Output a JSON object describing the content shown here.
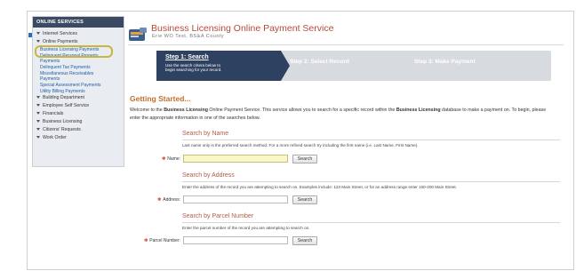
{
  "sidebar": {
    "heading": "ONLINE SERVICES",
    "items": [
      {
        "label": "Internet Services",
        "arrow": true
      },
      {
        "label": "Online Payments",
        "arrow": true
      }
    ],
    "payments_sub": [
      {
        "label": "Business Licensing Payments"
      },
      {
        "label": "Delinquent Personal Property Payments"
      },
      {
        "label": "Delinquent Tax Payments"
      },
      {
        "label": "Miscellaneous Receivables Payments"
      },
      {
        "label": "Special Assessment Payments"
      },
      {
        "label": "Utility Billing Payments"
      }
    ],
    "items2": [
      {
        "label": "Building Department"
      },
      {
        "label": "Employee Self Service"
      },
      {
        "label": "Financials"
      },
      {
        "label": "Business Licensing"
      },
      {
        "label": "Citizens' Requests"
      },
      {
        "label": "Work Order"
      }
    ]
  },
  "header": {
    "title": "Business Licensing Online Payment Service",
    "subtitle": "Erie WO Test, BS&A County"
  },
  "steps": {
    "step1_title": "Step 1: Search",
    "step1_desc": "Use the search critera below to begin searching for your record.",
    "step2": "Step 2: Select Record",
    "step3": "Step 3: Make Payment"
  },
  "main": {
    "heading": "Getting Started...",
    "intro_pre": "Welcome to the ",
    "intro_bold1": "Business Licensing",
    "intro_mid": " Online Payment Service. This service allows you to search for a specific record within the ",
    "intro_bold2": "Business Licensing",
    "intro_post": " database to make a payment on. To begin, please enter the appropriate information in one of the searches below.",
    "search_name": {
      "heading": "Search by Name",
      "hint": "Last name only is the preferred search method. For a more refined search try including the first name (i.e. Last Name, First Name).",
      "label": "Name:",
      "value": "",
      "button": "Search"
    },
    "search_address": {
      "heading": "Search by Address",
      "hint": "Enter the address of the record you are attempting to search on. Examples include: 123 Main Street, or for an address range enter 100-200 Main Street.",
      "label": "Address:",
      "value": "",
      "button": "Search"
    },
    "search_parcel": {
      "heading": "Search by Parcel Number",
      "hint": "Enter the parcel number of the record you are attempting to search on.",
      "label": "Parcel Number:",
      "value": "",
      "button": "Search"
    }
  }
}
